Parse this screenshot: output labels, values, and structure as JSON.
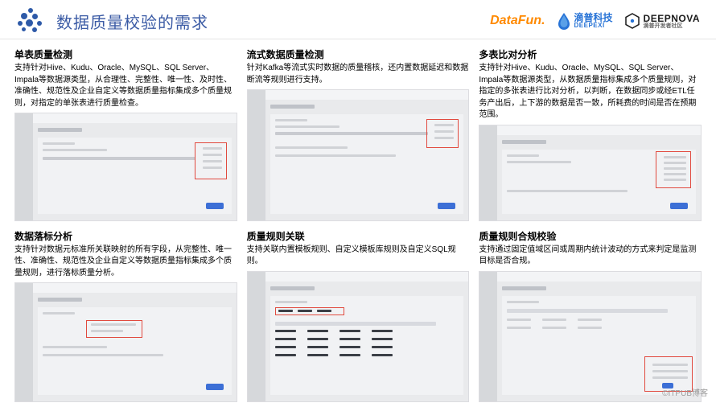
{
  "header": {
    "title": "数据质量校验的需求",
    "brands": {
      "datafun": "DataFun.",
      "deepexi_cn": "滴普科技",
      "deepexi_en": "DEEPEXI",
      "deepnova_en": "DEEPNOVA",
      "deepnova_cn": "滴普开发者社区"
    }
  },
  "cards": [
    {
      "title": "单表质量检测",
      "desc": "支持针对Hive、Kudu、Oracle、MySQL、SQL Server、Impala等数据源类型，从合理性、完整性、唯一性、及时性、准确性、规范性及企业自定义等数据质量指标集成多个质量规则，对指定的单张表进行质量检查。"
    },
    {
      "title": "流式数据质量检测",
      "desc": "针对Kafka等流式实时数据的质量稽核，还内置数据延迟和数据断流等规则进行支持。"
    },
    {
      "title": "多表比对分析",
      "desc": "支持针对Hive、Kudu、Oracle、MySQL、SQL Server、Impala等数据源类型，从数据质量指标集成多个质量规则，对指定的多张表进行比对分析，以判断，在数据同步或经ETL任务产出后，上下游的数据是否一致，所耗费的时间是否在预期范围。"
    },
    {
      "title": "数据落标分析",
      "desc": "支持针对数据元标准所关联映射的所有字段，从完整性、唯一性、准确性、规范性及企业自定义等数据质量指标集成多个质量规则，进行落标质量分析。"
    },
    {
      "title": "质量规则关联",
      "desc": "支持关联内置模板规则、自定义模板库规则及自定义SQL规则。"
    },
    {
      "title": "质量规则合规校验",
      "desc": "支持通过固定值域区间或周期内统计波动的方式来判定是监测目标是否合规。"
    }
  ],
  "watermark": "©ITPUB博客"
}
